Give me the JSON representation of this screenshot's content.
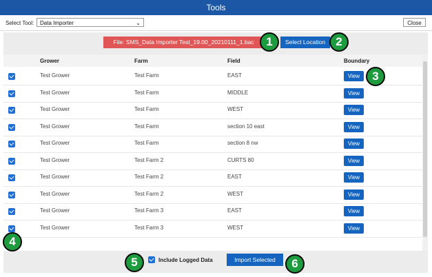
{
  "window": {
    "title": "Tools"
  },
  "toolbar": {
    "select_label": "Select Tool:",
    "select_value": "Data Importer",
    "close_label": "Close"
  },
  "file": {
    "label": "File: SMS_Data Importer Test_19.00_20210111_1.bac",
    "select_location_label": "Select Location"
  },
  "table": {
    "headers": {
      "grower": "Grower",
      "farm": "Farm",
      "field": "Field",
      "boundary": "Boundary"
    },
    "view_label": "View",
    "rows": [
      {
        "grower": "Test Grower",
        "farm": "Test Farm",
        "field": "EAST"
      },
      {
        "grower": "Test Grower",
        "farm": "Test Farm",
        "field": "MIDDLE"
      },
      {
        "grower": "Test Grower",
        "farm": "Test Farm",
        "field": "WEST"
      },
      {
        "grower": "Test Grower",
        "farm": "Test Farm",
        "field": "section 10 east"
      },
      {
        "grower": "Test Grower",
        "farm": "Test Farm",
        "field": "section 8 nw"
      },
      {
        "grower": "Test Grower",
        "farm": "Test Farm 2",
        "field": "CURTS 80"
      },
      {
        "grower": "Test Grower",
        "farm": "Test Farm 2",
        "field": "EAST"
      },
      {
        "grower": "Test Grower",
        "farm": "Test Farm 2",
        "field": "WEST"
      },
      {
        "grower": "Test Grower",
        "farm": "Test Farm 3",
        "field": "EAST"
      },
      {
        "grower": "Test Grower",
        "farm": "Test Farm 3",
        "field": "WEST"
      }
    ]
  },
  "footer": {
    "include_logged_label": "Include Logged Data",
    "import_label": "Import Selected"
  },
  "callouts": [
    "1",
    "2",
    "3",
    "4",
    "5",
    "6"
  ],
  "colors": {
    "title_bar": "#1c57a5",
    "primary_button": "#1565c0",
    "file_bar": "#e05555",
    "callout": "#1e9b3e"
  }
}
